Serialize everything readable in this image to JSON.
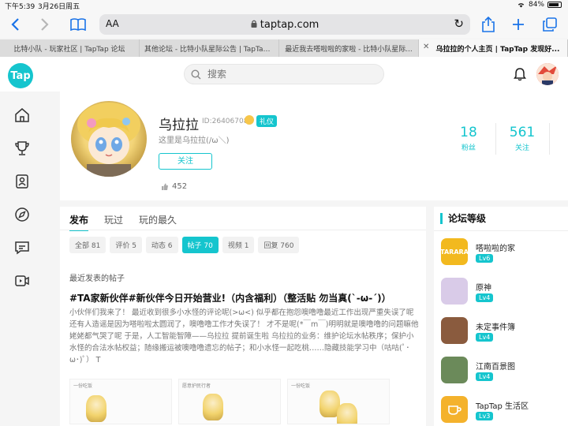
{
  "status_bar": {
    "time": "下午5:39",
    "date": "3月26日周五",
    "wifi": "wifi-icon",
    "battery_pct": "84%",
    "battery_level": 0.84
  },
  "browser": {
    "text_size_label": "AA",
    "domain": "taptap.com",
    "tabs": [
      {
        "title": "比特小队 - 玩家社区 | TapTap 论坛",
        "active": false
      },
      {
        "title": "其他论坛 - 比特小队星际公告 | TapTap...",
        "active": false
      },
      {
        "title": "最近我去嗒啦啦的家啦 - 比特小队星际...",
        "active": false
      },
      {
        "title": "乌拉拉的个人主页 | TapTap 发现好...",
        "active": true
      }
    ]
  },
  "header": {
    "logo": "Tap",
    "search_placeholder": "搜索"
  },
  "profile": {
    "name": "乌拉拉",
    "id": "ID:26406708",
    "badge": "礼仪",
    "bio": "这里是乌拉拉(/ω＼)",
    "follow_label": "关注",
    "likes": "452",
    "stats": [
      {
        "num": "18",
        "label": "粉丝"
      },
      {
        "num": "561",
        "label": "关注"
      }
    ]
  },
  "main": {
    "tabs": [
      "发布",
      "玩过",
      "玩的最久"
    ],
    "chips": [
      {
        "label": "全部 81",
        "active": false
      },
      {
        "label": "评价 5",
        "active": false
      },
      {
        "label": "动态 6",
        "active": false
      },
      {
        "label": "帖子 70",
        "active": true
      },
      {
        "label": "视频 1",
        "active": false
      },
      {
        "label": "回复 760",
        "active": false
      }
    ],
    "section_label": "最近发表的帖子",
    "post": {
      "title": "#TA家新伙伴#新伙伴今日开始营业!（内含福利）（整活贴 勿当真(`-ω-´)）",
      "body": "小伙伴们我来了！ 最近收到很多小水怪的评论呢(>ω<) 似乎都在抱怨噢噜噜最近工作出现严重失误了呢 还有人造谣是因为嗒啦啦太圆润了，噢噜噜工作才失误了！ 才不是呢(*￣m￣)明明就是噢噜噜的问题嘛他姥姥都气哭了呢 于是，人工智能智障——乌拉拉 提前诞生啦 乌拉拉的业务：维护论坛水帖秩序；保护小水怪的合法水帖权益；随缘搬运被噢噜噜遗忘的帖子；和小水怪一起吃桃……隐藏技能学习中（咕咕(ﾟ･ω･)ﾟ） T"
    },
    "thumbs": [
      {
        "meta": "一份吃饭"
      },
      {
        "meta": "愿意护民行者"
      },
      {
        "meta": "一份吃饭"
      }
    ]
  },
  "sidebar": {
    "title": "论坛等级",
    "forums": [
      {
        "name": "嗒啦啦的家",
        "level": "Lv6",
        "icon_text": "TARARA",
        "color": "#f2b91f"
      },
      {
        "name": "原神",
        "level": "Lv4",
        "icon_text": "",
        "color": "#d9cbe8"
      },
      {
        "name": "未定事件簿",
        "level": "Lv4",
        "icon_text": "",
        "color": "#8a5b3e"
      },
      {
        "name": "江南百景图",
        "level": "Lv4",
        "icon_text": "",
        "color": "#6b8a5a"
      },
      {
        "name": "TapTap 生活区",
        "level": "Lv3",
        "icon_text": "",
        "color": "#f4b22c"
      }
    ]
  }
}
